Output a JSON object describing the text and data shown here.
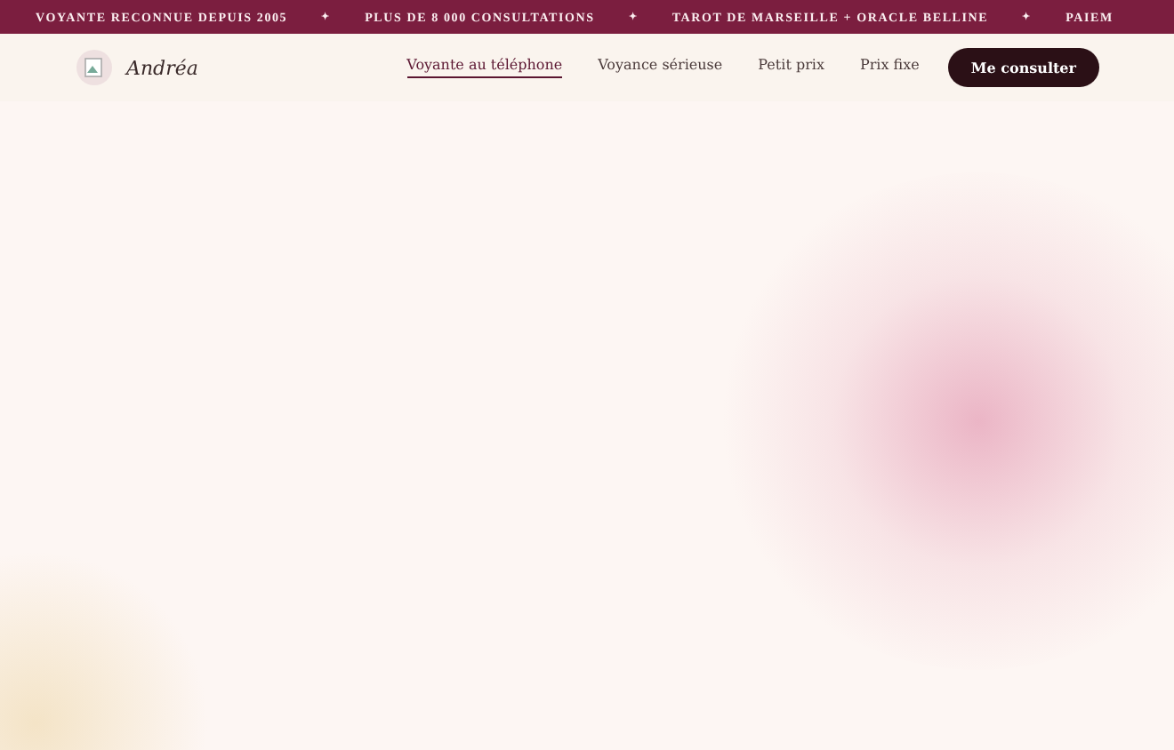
{
  "ticker": {
    "items": [
      "VOYANTE RECONNUE DEPUIS 2005",
      "PLUS DE 8 000 CONSULTATIONS",
      "TAROT DE MARSEILLE + ORACLE BELLINE",
      "PAIEM"
    ],
    "separator": "✦"
  },
  "header": {
    "logo_text": "Andréa",
    "nav": [
      {
        "label": "Voyante au téléphone",
        "selected": true
      },
      {
        "label": "Voyance sérieuse",
        "selected": false
      },
      {
        "label": "Petit prix",
        "selected": false
      },
      {
        "label": "Prix fixe",
        "selected": false
      }
    ],
    "cta": "Me consulter"
  }
}
